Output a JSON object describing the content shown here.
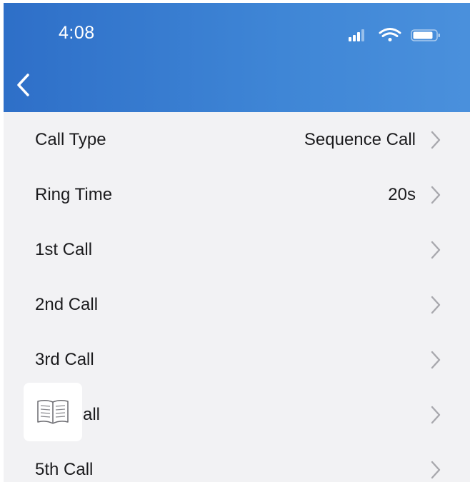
{
  "status_bar": {
    "time": "4:08",
    "icons": [
      "signal-icon",
      "wifi-icon",
      "battery-icon"
    ]
  },
  "nav": {
    "back_icon": "chevron-left-icon"
  },
  "settings": [
    {
      "label": "Call Type",
      "value": "Sequence Call"
    },
    {
      "label": "Ring Time",
      "value": "20s"
    },
    {
      "label": "1st Call",
      "value": ""
    },
    {
      "label": "2nd Call",
      "value": ""
    },
    {
      "label": "3rd Call",
      "value": ""
    },
    {
      "label": "all",
      "value": ""
    },
    {
      "label": "5th Call",
      "value": ""
    }
  ],
  "overlay": {
    "icon": "book-icon"
  },
  "colors": {
    "header_start": "#2e6fc8",
    "header_end": "#4a90dc",
    "background": "#f2f2f4",
    "chevron": "#a8a8ad"
  }
}
